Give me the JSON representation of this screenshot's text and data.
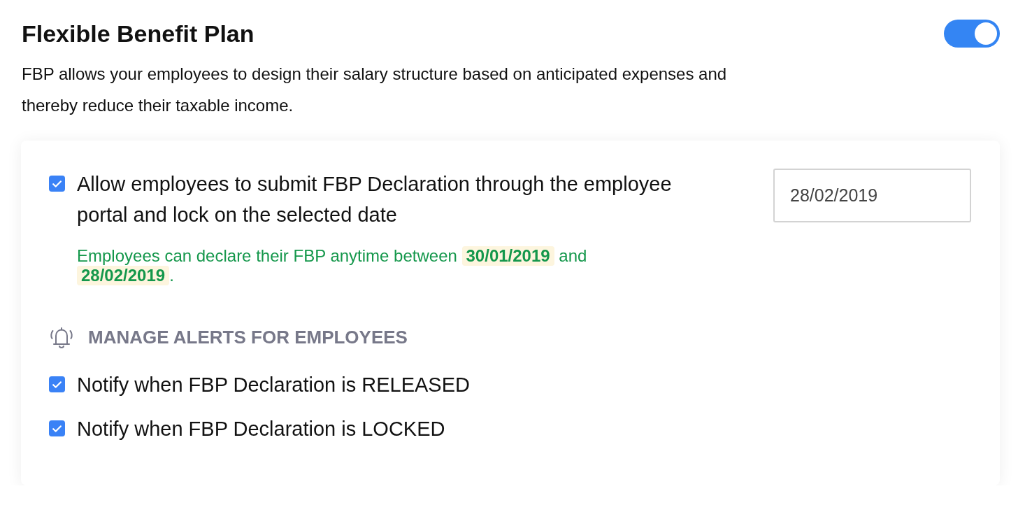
{
  "header": {
    "title": "Flexible Benefit Plan",
    "toggle": {
      "on": true
    },
    "description": "FBP allows your employees to design their salary structure based on anticipated expenses and thereby reduce their taxable income."
  },
  "declaration": {
    "checked": true,
    "label": "Allow employees to submit FBP Declaration through the employee portal and lock on the selected date",
    "date_field": {
      "value": "28/02/2019"
    },
    "note": [
      {
        "kind": "text",
        "text": "Employees can declare their FBP anytime between "
      },
      {
        "kind": "date",
        "text": "30/01/2019"
      },
      {
        "kind": "text",
        "text": " and "
      },
      {
        "kind": "date",
        "text": "28/02/2019"
      },
      {
        "kind": "text",
        "text": "."
      }
    ]
  },
  "alerts": {
    "heading": "MANAGE ALERTS FOR EMPLOYEES",
    "items": [
      {
        "label": "Notify when FBP Declaration is RELEASED",
        "checked": true
      },
      {
        "label": "Notify when FBP Declaration is LOCKED",
        "checked": true
      }
    ]
  }
}
